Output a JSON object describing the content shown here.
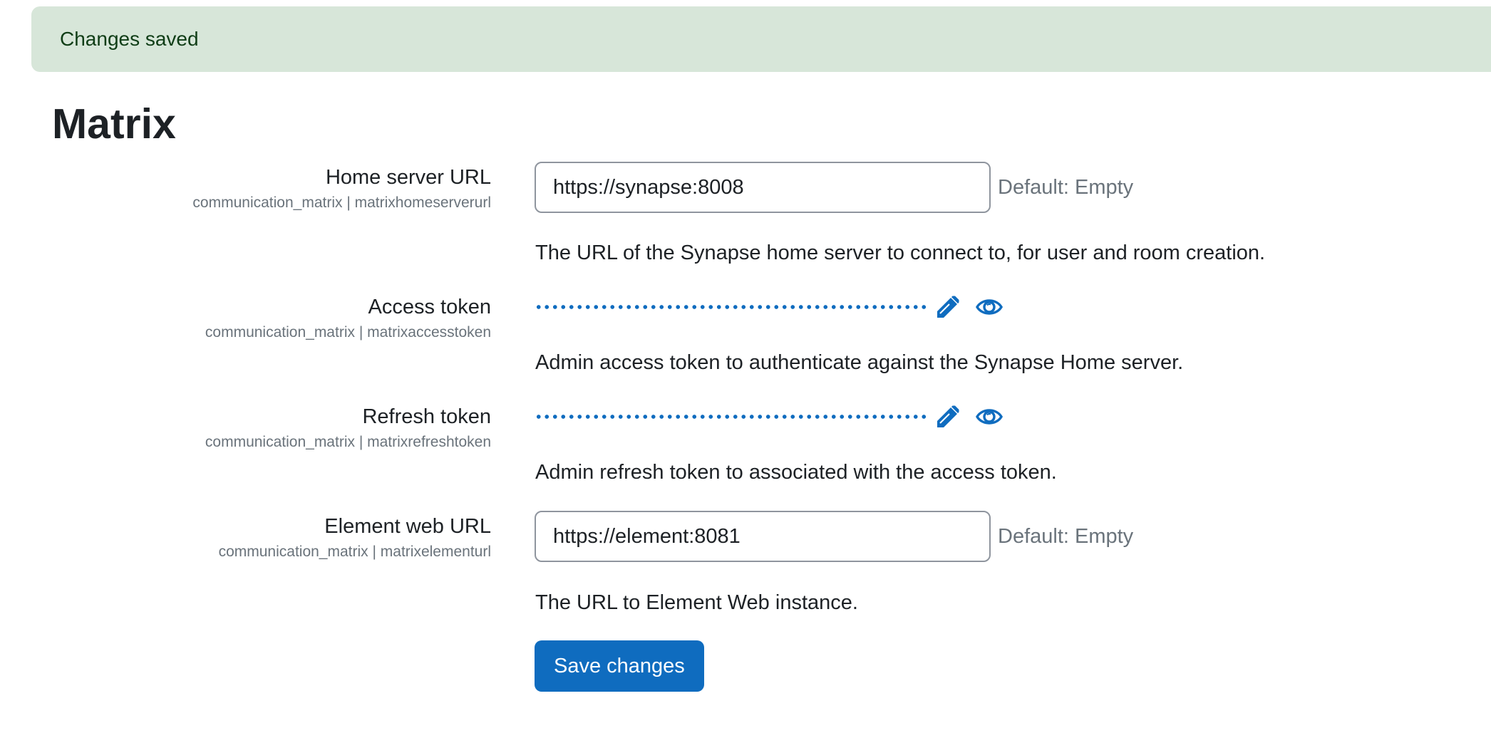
{
  "alert": {
    "message": "Changes saved"
  },
  "page_title": "Matrix",
  "settings": {
    "homeserver": {
      "label": "Home server URL",
      "key": "communication_matrix | matrixhomeserverurl",
      "value": "https://synapse:8008",
      "default_note": "Default: Empty",
      "description": "The URL of the Synapse home server to connect to, for user and room creation."
    },
    "access_token": {
      "label": "Access token",
      "key": "communication_matrix | matrixaccesstoken",
      "description": "Admin access token to authenticate against the Synapse Home server."
    },
    "refresh_token": {
      "label": "Refresh token",
      "key": "communication_matrix | matrixrefreshtoken",
      "description": "Admin refresh token to associated with the access token."
    },
    "element_url": {
      "label": "Element web URL",
      "key": "communication_matrix | matrixelementurl",
      "value": "https://element:8081",
      "default_note": "Default: Empty",
      "description": "The URL to Element Web instance."
    }
  },
  "icons": {
    "edit": "pencil-icon",
    "reveal": "eye-icon"
  },
  "colors": {
    "primary": "#0f6cbf",
    "success_bg": "#d7e6d9",
    "muted": "#6a737b"
  },
  "save_button": {
    "label": "Save changes"
  }
}
